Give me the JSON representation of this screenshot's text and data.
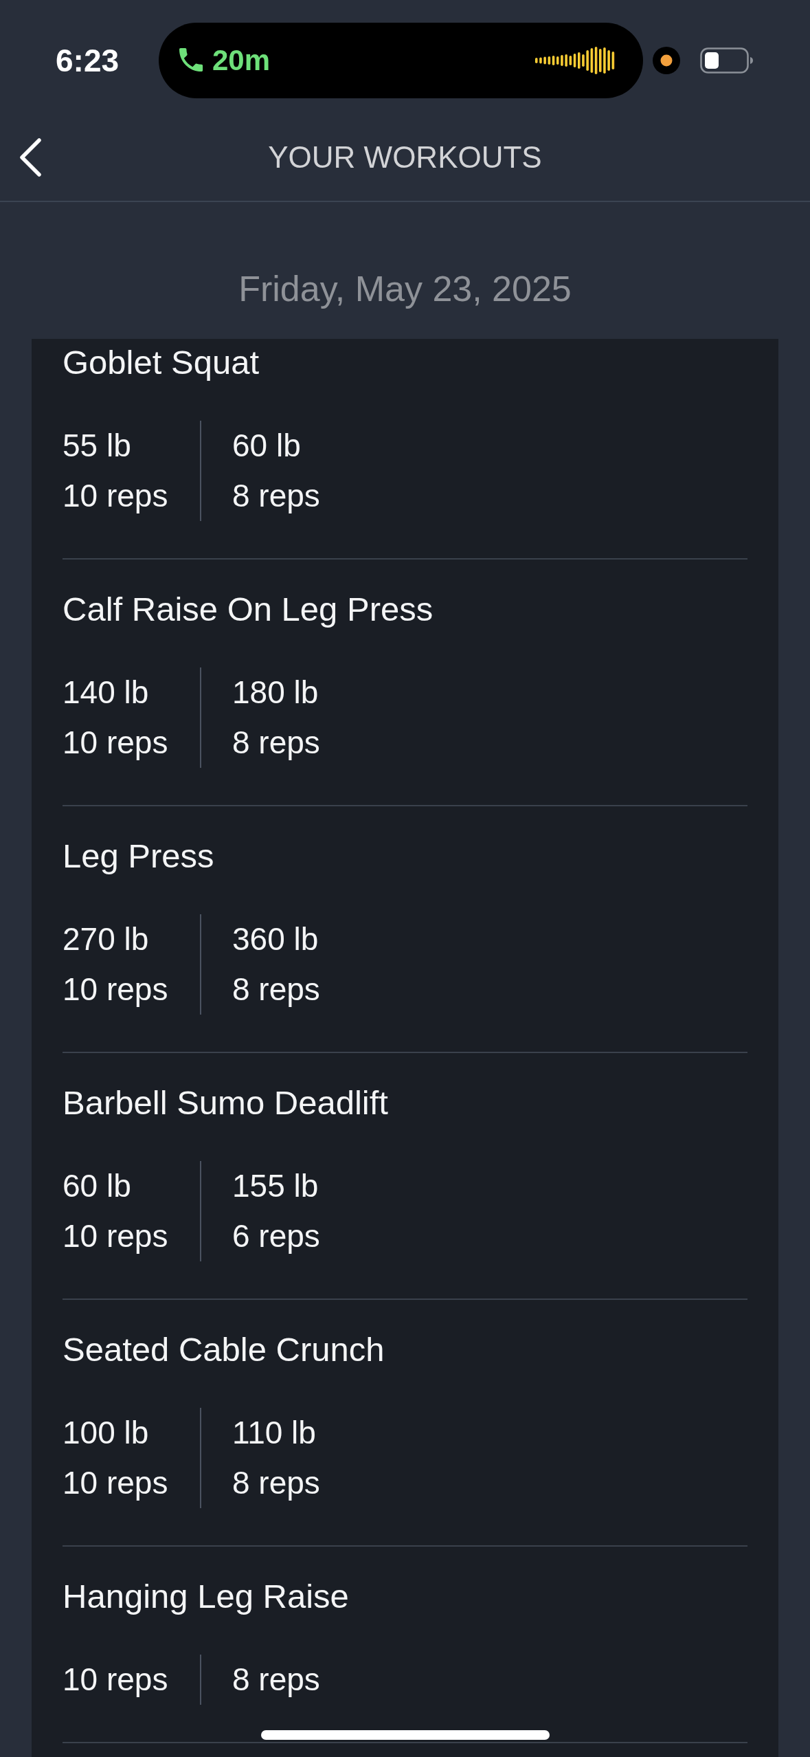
{
  "status_bar": {
    "time": "6:23",
    "call_duration": "20m"
  },
  "header": {
    "title": "YOUR WORKOUTS"
  },
  "date": "Friday, May 23, 2025",
  "exercises": [
    {
      "name": "Goblet Squat",
      "sets": [
        {
          "weight": "55 lb",
          "reps": "10 reps"
        },
        {
          "weight": "60 lb",
          "reps": "8 reps"
        }
      ]
    },
    {
      "name": "Calf Raise On Leg Press",
      "sets": [
        {
          "weight": "140 lb",
          "reps": "10 reps"
        },
        {
          "weight": "180 lb",
          "reps": "8 reps"
        }
      ]
    },
    {
      "name": "Leg Press",
      "sets": [
        {
          "weight": "270 lb",
          "reps": "10 reps"
        },
        {
          "weight": "360 lb",
          "reps": "8 reps"
        }
      ]
    },
    {
      "name": "Barbell Sumo Deadlift",
      "sets": [
        {
          "weight": "60 lb",
          "reps": "10 reps"
        },
        {
          "weight": "155 lb",
          "reps": "6 reps"
        }
      ]
    },
    {
      "name": "Seated Cable Crunch",
      "sets": [
        {
          "weight": "100 lb",
          "reps": "10 reps"
        },
        {
          "weight": "110 lb",
          "reps": "8 reps"
        }
      ]
    },
    {
      "name": "Hanging Leg Raise",
      "sets": [
        {
          "reps": "10 reps"
        },
        {
          "reps": "8 reps"
        }
      ]
    }
  ]
}
